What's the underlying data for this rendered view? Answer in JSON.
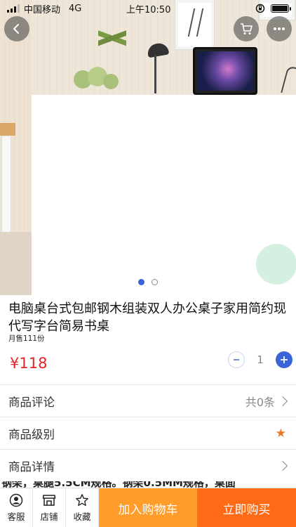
{
  "status_bar": {
    "carrier": "中国移动",
    "network": "4G",
    "time": "上午10:50"
  },
  "top_nav": {
    "back_icon": "chevron-left-icon",
    "cart_icon": "shopping-cart-icon",
    "more_icon": "more-horizontal-icon"
  },
  "carousel": {
    "slide_count": 2,
    "active_index": 0
  },
  "product": {
    "title": "电脑桌台式包邮钢木组装双人办公桌子家用简约现代写字台简易书桌",
    "monthly_sales": "月售111份",
    "price": "¥118",
    "quantity": "1",
    "price_color": "#e6222b"
  },
  "rows": {
    "reviews_label": "商品评论",
    "reviews_count": "共0条",
    "level_label": "商品级别",
    "details_label": "商品详情"
  },
  "description_snippet": "钢架，桌腿5.5CM规格。钢架0.5MM规格，桌面",
  "bottom_bar": {
    "service_label": "客服",
    "store_label": "店铺",
    "favorite_label": "收藏",
    "add_to_cart_label": "加入购物车",
    "buy_now_label": "立即购买",
    "add_to_cart_color": "#ff9c2a",
    "buy_now_color": "#ff6a16"
  }
}
